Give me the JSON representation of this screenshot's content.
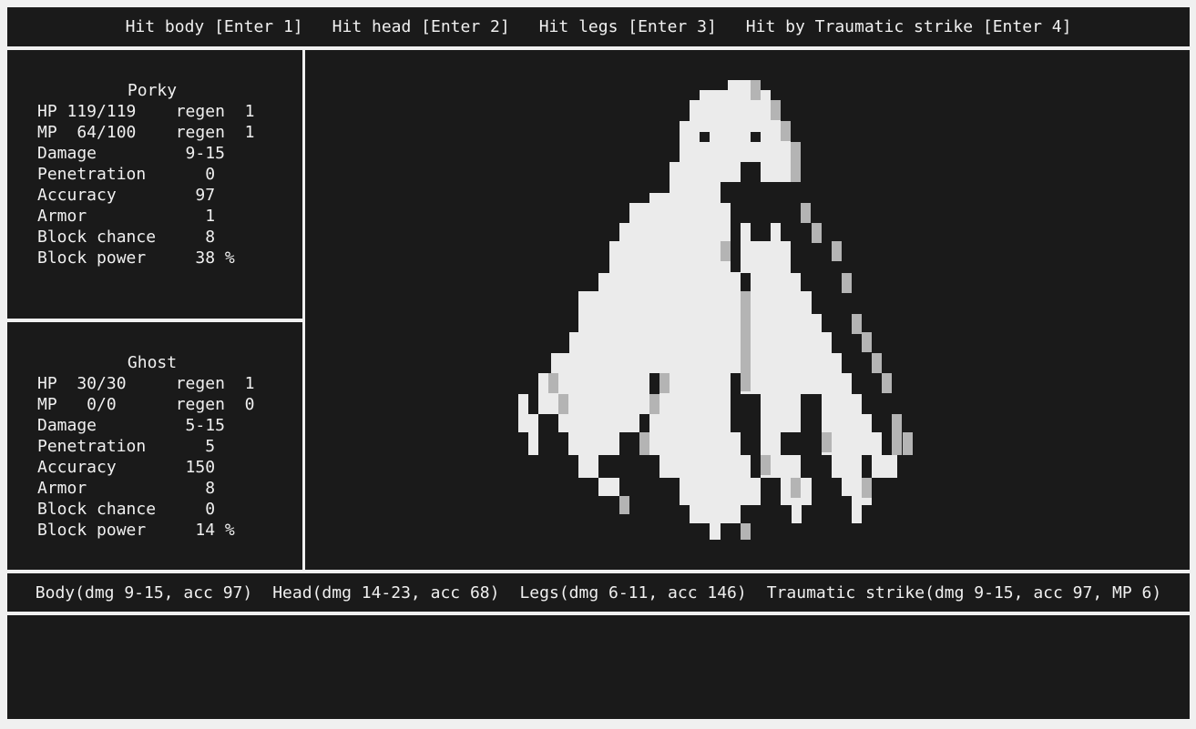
{
  "actions": [
    {
      "label": "Hit body [Enter 1]"
    },
    {
      "label": "Hit head [Enter 2]"
    },
    {
      "label": "Hit legs [Enter 3]"
    },
    {
      "label": "Hit by Traumatic strike [Enter 4]"
    }
  ],
  "player": {
    "name": "Porky",
    "rows": [
      "HP 119/119    regen  1",
      "MP  64/100    regen  1",
      "Damage         9-15",
      "Penetration      0",
      "Accuracy        97",
      "Armor            1",
      "Block chance     8",
      "Block power     38 %"
    ]
  },
  "enemy": {
    "name": "Ghost",
    "rows": [
      "HP  30/30     regen  1",
      "MP   0/0      regen  0",
      "Damage         5-15",
      "Penetration      5",
      "Accuracy       150",
      "Armor            8",
      "Block chance     0",
      "Block power     14 %"
    ]
  },
  "attacks": [
    {
      "label": "Body(dmg 9-15, acc 97)"
    },
    {
      "label": "Head(dmg 14-23, acc 68)"
    },
    {
      "label": "Legs(dmg 6-11, acc 146)"
    },
    {
      "label": "Traumatic strike(dmg 9-15, acc 97, MP 6)"
    }
  ],
  "colors": {
    "background": "#1a1a1a",
    "frame": "#f0f0f0",
    "text": "#f0f0f0",
    "ghost_body": "#ebebeb",
    "ghost_shade": "#b4b4b4",
    "ghost_eyes": "#1a1a1a"
  },
  "portrait": {
    "icon": "ghost-sprite-icon"
  }
}
